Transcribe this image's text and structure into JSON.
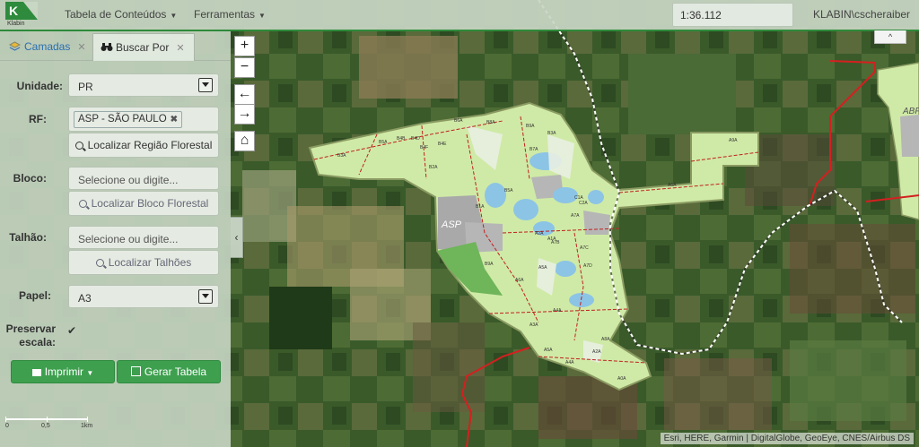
{
  "brand": {
    "logo_letter": "K",
    "logo_text": "Klabin"
  },
  "topbar": {
    "menus": [
      {
        "label": "Tabela de Conteúdos"
      },
      {
        "label": "Ferramentas"
      }
    ],
    "scale": "1:36.112",
    "user": "KLABIN\\cscheraiber"
  },
  "tabs": [
    {
      "label": "Camadas",
      "active": false
    },
    {
      "label": "Buscar Por",
      "active": true
    }
  ],
  "form": {
    "unidade": {
      "label": "Unidade:",
      "value": "PR"
    },
    "rf": {
      "label": "RF:",
      "tag": "ASP - SÃO PAULO",
      "button": "Localizar Região Florestal"
    },
    "bloco": {
      "label": "Bloco:",
      "placeholder": "Selecione ou digite...",
      "button": "Localizar Bloco Florestal"
    },
    "talhao": {
      "label": "Talhão:",
      "placeholder": "Selecione ou digite...",
      "button": "Localizar Talhões"
    },
    "papel": {
      "label": "Papel:",
      "value": "A3"
    },
    "preservar": {
      "label_line1": "Preservar",
      "label_line2": "escala:",
      "checked": true
    },
    "imprimir_button": "Imprimir",
    "gerar_button": "Gerar Tabela"
  },
  "scalebar": {
    "labels": [
      "0",
      "0,5",
      "1km"
    ]
  },
  "map": {
    "attribution": "Esri, HERE, Garmin | DigitalGlobe, GeoEye, CNES/Airbus DS",
    "asp_label": "ASP",
    "abf_label": "ABF",
    "block_labels": [
      "B3A",
      "B5A",
      "B4B",
      "B4D",
      "B4F",
      "B4E",
      "B2A",
      "B6A",
      "B8A",
      "B9A",
      "B3A",
      "B7A",
      "B1A",
      "B5A",
      "A1A",
      "A2A",
      "A7A",
      "A7B",
      "A7C",
      "A7D",
      "A5A",
      "A6A",
      "A4A",
      "A3A",
      "B9A",
      "C1A",
      "C2A",
      "A6A",
      "A9A",
      "A8A",
      "A0A",
      "A2A",
      "A4A",
      "A5A"
    ],
    "controls": {
      "zoom_in": "+",
      "zoom_out": "−",
      "back": "←",
      "forward": "→",
      "home": "⌂",
      "collapse_up": "^"
    }
  },
  "colors": {
    "accent": "#2d8a3a",
    "button_green": "#3ea04f",
    "farm_fill": "#cfeaa6",
    "boundary": "#d42020"
  }
}
